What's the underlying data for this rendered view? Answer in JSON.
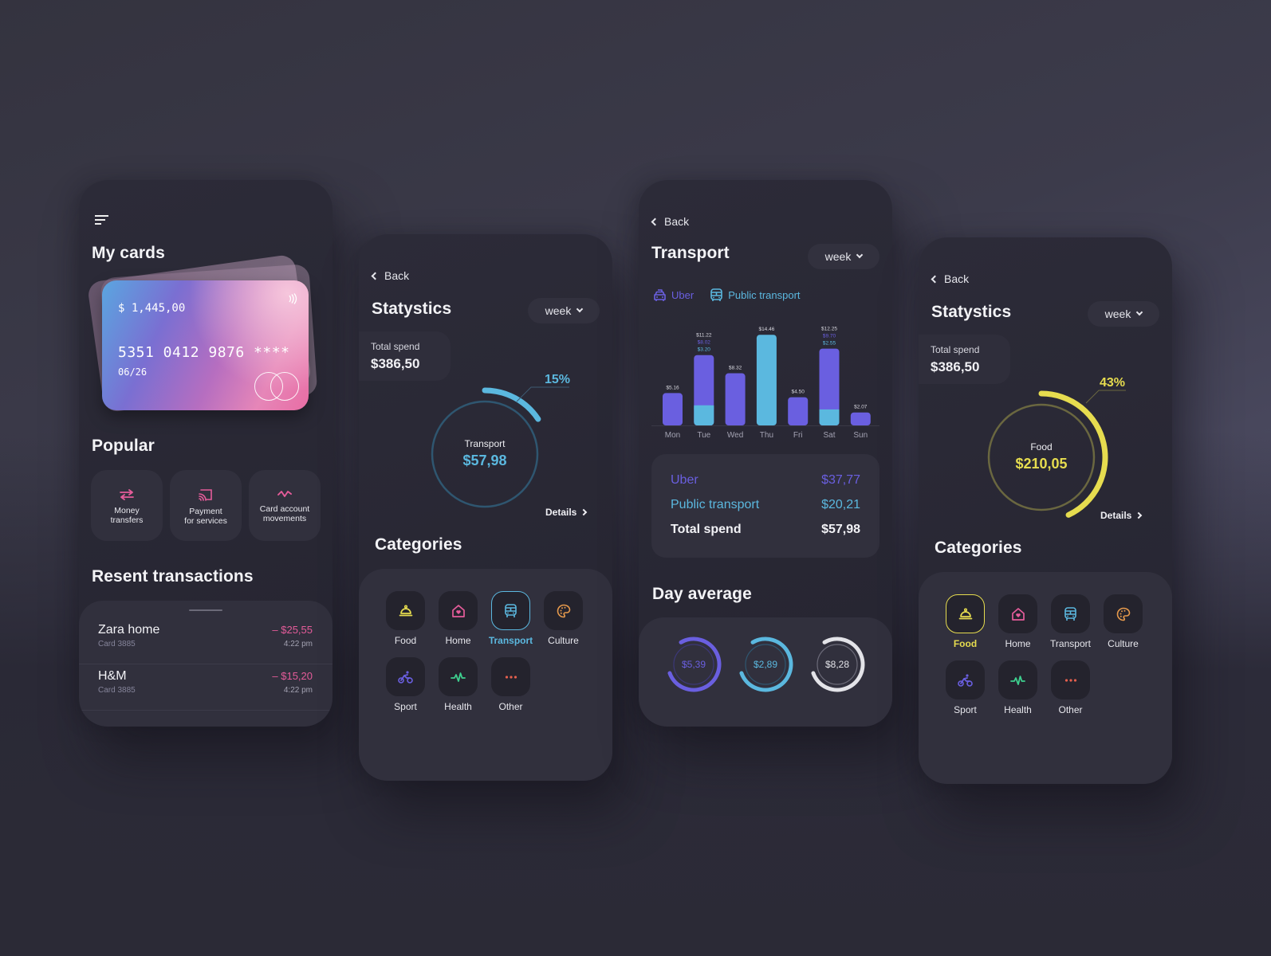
{
  "colors": {
    "pink": "#e55c9a",
    "blue": "#5bb8df",
    "purple": "#6a5fe0",
    "yellow": "#e6dc4f",
    "green": "#3ecf8e",
    "orange": "#e79a4c",
    "red": "#e5604e",
    "white": "#e3e3e8"
  },
  "screen1": {
    "title": "My cards",
    "card": {
      "balance": "$ 1,445,00",
      "number": "5351 0412 9876 ****",
      "expiry": "06/26"
    },
    "popular_title": "Popular",
    "popular": [
      {
        "label_line1": "Money",
        "label_line2": "transfers",
        "icon": "transfer-arrows-icon"
      },
      {
        "label_line1": "Payment",
        "label_line2": "for services",
        "icon": "cast-payment-icon"
      },
      {
        "label_line1": "Card account",
        "label_line2": "movements",
        "icon": "activity-wave-icon"
      }
    ],
    "transactions_title": "Resent transactions",
    "transactions": [
      {
        "name": "Zara home",
        "card": "Card 3885",
        "amount": "– $25,55",
        "time": "4:22 pm"
      },
      {
        "name": "H&M",
        "card": "Card 3885",
        "amount": "– $15,20",
        "time": "4:22 pm"
      }
    ]
  },
  "screen2": {
    "back": "Back",
    "title": "Statystics",
    "period": "week",
    "total_label": "Total spend",
    "total_value": "$386,50",
    "donut": {
      "category": "Transport",
      "value": "$57,98",
      "percent_label": "15%",
      "percent": 15
    },
    "details": "Details",
    "categories_title": "Categories",
    "selected": "Transport"
  },
  "screen3": {
    "back": "Back",
    "title": "Transport",
    "period": "week",
    "legend": [
      {
        "label": "Uber",
        "icon": "car-icon"
      },
      {
        "label": "Public transport",
        "icon": "bus-icon"
      }
    ],
    "summary": [
      {
        "label": "Uber",
        "value": "$37,77"
      },
      {
        "label": "Public transport",
        "value": "$20,21"
      },
      {
        "label": "Total spend",
        "value": "$57,98"
      }
    ],
    "day_average_title": "Day average",
    "day_average": [
      {
        "value": "$5,39",
        "fraction": 0.75
      },
      {
        "value": "$2,89",
        "fraction": 0.75
      },
      {
        "value": "$8,28",
        "fraction": 0.75
      }
    ]
  },
  "screen4": {
    "back": "Back",
    "title": "Statystics",
    "period": "week",
    "total_label": "Total spend",
    "total_value": "$386,50",
    "donut": {
      "category": "Food",
      "value": "$210,05",
      "percent_label": "43%",
      "percent": 43
    },
    "details": "Details",
    "categories_title": "Categories",
    "selected": "Food"
  },
  "categories": [
    {
      "label": "Food",
      "icon": "food-cloche-icon",
      "color": "#e6dc4f"
    },
    {
      "label": "Home",
      "icon": "home-heart-icon",
      "color": "#e55c9a"
    },
    {
      "label": "Transport",
      "icon": "bus-icon",
      "color": "#5bb8df"
    },
    {
      "label": "Culture",
      "icon": "palette-icon",
      "color": "#e79a4c"
    },
    {
      "label": "Sport",
      "icon": "bicycle-icon",
      "color": "#6a5fe0"
    },
    {
      "label": "Health",
      "icon": "pulse-icon",
      "color": "#3ecf8e"
    },
    {
      "label": "Other",
      "icon": "more-dots-icon",
      "color": "#e5604e"
    }
  ],
  "chart_data": {
    "type": "bar",
    "title": "Transport",
    "stacked": true,
    "categories": [
      "Mon",
      "Tue",
      "Wed",
      "Thu",
      "Fri",
      "Sat",
      "Sun"
    ],
    "series": [
      {
        "name": "Public transport",
        "color": "#5bb8df",
        "values": [
          0,
          3.2,
          0,
          14.46,
          0,
          2.55,
          0
        ]
      },
      {
        "name": "Uber",
        "color": "#6a5fe0",
        "values": [
          5.16,
          8.02,
          8.32,
          0,
          4.5,
          9.7,
          2.07
        ]
      }
    ],
    "totals": [
      5.16,
      11.22,
      8.32,
      14.46,
      4.5,
      12.25,
      2.07
    ],
    "total_labels": [
      "$5.16",
      "$11.22",
      "$8.32",
      "$14.46",
      "$4.50",
      "$12.25",
      "$2.07"
    ],
    "breakdown_labels": {
      "Tue": {
        "uber": "$8.02",
        "public": "$3.20"
      },
      "Sat": {
        "uber": "$9.70",
        "public": "$2.55"
      }
    },
    "ylim": [
      0,
      15
    ],
    "grid": false,
    "legend": "top-left",
    "xlabel": "",
    "ylabel": ""
  }
}
